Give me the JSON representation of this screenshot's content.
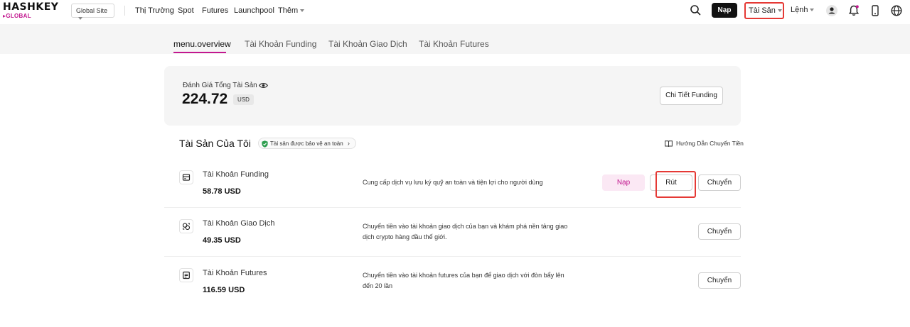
{
  "brand": {
    "logo_main": "HASHKEY",
    "logo_sub": "▸GLOBAL",
    "accent_color": "#c2178f"
  },
  "header": {
    "site_select": "Global Site",
    "nav": [
      "Thị Trường",
      "Spot",
      "Futures",
      "Launchpool",
      "Thêm"
    ],
    "deposit_label": "Nạp",
    "assets_label": "Tài Sản",
    "orders_label": "Lệnh"
  },
  "tabs": [
    "menu.overview",
    "Tài Khoản Funding",
    "Tài Khoản Giao Dịch",
    "Tài Khoản Futures"
  ],
  "summary": {
    "label": "Đánh Giá Tổng Tài Sản",
    "amount": "224.72",
    "unit": "USD",
    "detail_button": "Chi Tiết Funding"
  },
  "assets": {
    "title": "Tài Sản Của Tôi",
    "safe_badge": "Tài sản được bảo vệ an toàn",
    "guide_link": "Hướng Dẫn Chuyển Tiền",
    "accounts": [
      {
        "name": "Tài Khoản Funding",
        "amount": "58.78 USD",
        "description": "Cung cấp dịch vụ lưu ký quỹ an toàn và tiện lợi cho người dùng",
        "deposit": "Nạp",
        "withdraw": "Rút",
        "transfer": "Chuyển"
      },
      {
        "name": "Tài Khoản Giao Dịch",
        "amount": "49.35 USD",
        "description": "Chuyển tiền vào tài khoản giao dịch của bạn và khám phá nền tảng giao dịch crypto hàng đầu thế giới.",
        "transfer": "Chuyển"
      },
      {
        "name": "Tài Khoản Futures",
        "amount": "116.59 USD",
        "description": "Chuyển tiền vào tài khoản futures của bạn để giao dịch với đòn bẩy lên đến 20 lần",
        "transfer": "Chuyển"
      }
    ]
  }
}
